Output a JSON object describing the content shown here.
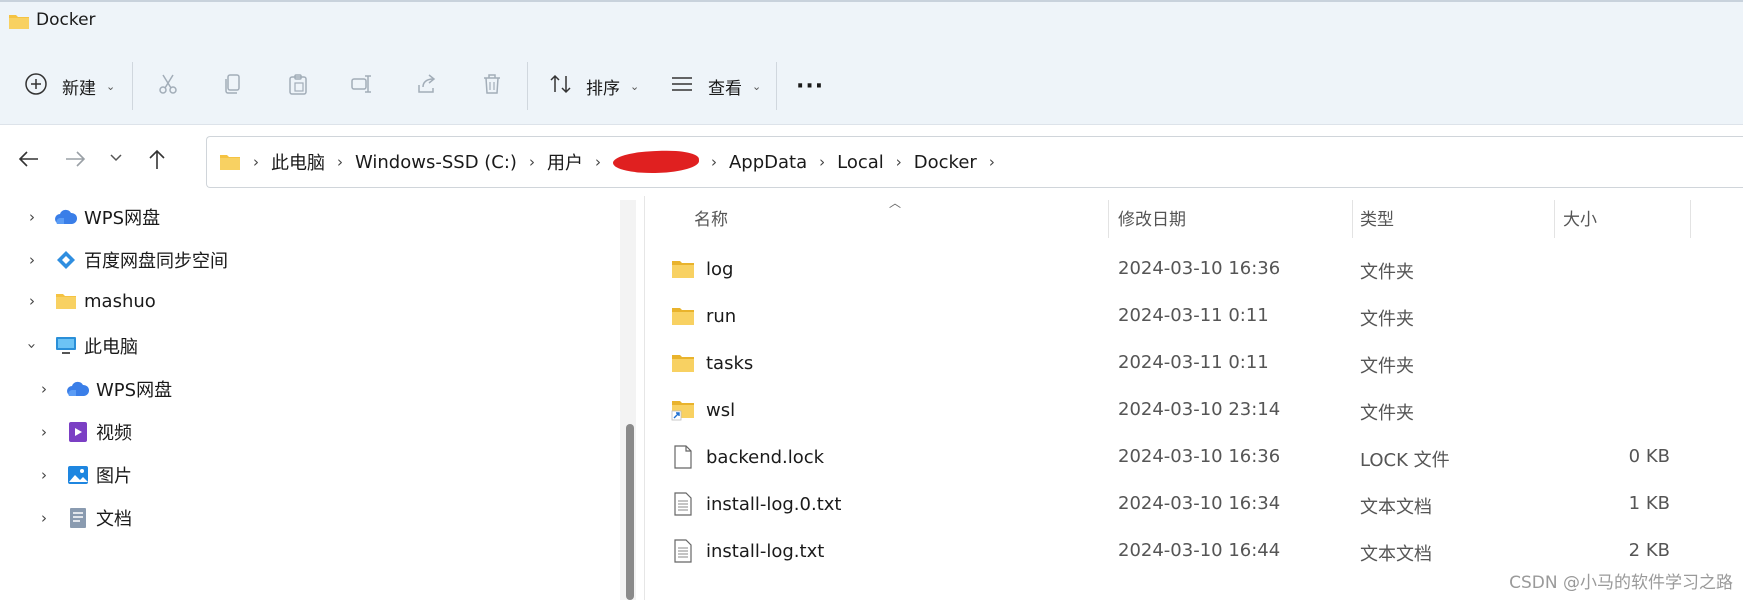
{
  "window": {
    "title": "Docker"
  },
  "toolbar": {
    "new_label": "新建",
    "sort_label": "排序",
    "view_label": "查看",
    "more_label": "···"
  },
  "breadcrumb": {
    "items": [
      "此电脑",
      "Windows-SSD (C:)",
      "用户",
      "AppData",
      "Local",
      "Docker"
    ]
  },
  "nav": {
    "items": [
      {
        "label": "WPS网盘",
        "icon": "cloud-icon",
        "expanded": false,
        "indent": 0
      },
      {
        "label": "百度网盘同步空间",
        "icon": "baidu-netdisk-icon",
        "expanded": false,
        "indent": 0
      },
      {
        "label": "mashuo",
        "icon": "folder-icon",
        "expanded": false,
        "indent": 0
      },
      {
        "label": "此电脑",
        "icon": "computer-icon",
        "expanded": true,
        "indent": 0
      },
      {
        "label": "WPS网盘",
        "icon": "cloud-icon",
        "expanded": false,
        "indent": 1
      },
      {
        "label": "视频",
        "icon": "video-icon",
        "expanded": false,
        "indent": 1
      },
      {
        "label": "图片",
        "icon": "pictures-icon",
        "expanded": false,
        "indent": 1
      },
      {
        "label": "文档",
        "icon": "documents-icon",
        "expanded": false,
        "indent": 1
      }
    ]
  },
  "list": {
    "columns": [
      "名称",
      "修改日期",
      "类型",
      "大小"
    ],
    "rows": [
      {
        "name": "log",
        "date": "2024-03-10 16:36",
        "type": "文件夹",
        "size": "",
        "icon": "folder-icon"
      },
      {
        "name": "run",
        "date": "2024-03-11 0:11",
        "type": "文件夹",
        "size": "",
        "icon": "folder-icon"
      },
      {
        "name": "tasks",
        "date": "2024-03-11 0:11",
        "type": "文件夹",
        "size": "",
        "icon": "folder-icon"
      },
      {
        "name": "wsl",
        "date": "2024-03-10 23:14",
        "type": "文件夹",
        "size": "",
        "icon": "folder-shortcut-icon"
      },
      {
        "name": "backend.lock",
        "date": "2024-03-10 16:36",
        "type": "LOCK 文件",
        "size": "0 KB",
        "icon": "blank-file-icon"
      },
      {
        "name": "install-log.0.txt",
        "date": "2024-03-10 16:34",
        "type": "文本文档",
        "size": "1 KB",
        "icon": "text-file-icon"
      },
      {
        "name": "install-log.txt",
        "date": "2024-03-10 16:44",
        "type": "文本文档",
        "size": "2 KB",
        "icon": "text-file-icon"
      }
    ]
  },
  "watermark": "CSDN @小马的软件学习之路",
  "colors": {
    "folder": "#f5c342",
    "accent": "#0067c0",
    "redaction": "#e02020"
  }
}
